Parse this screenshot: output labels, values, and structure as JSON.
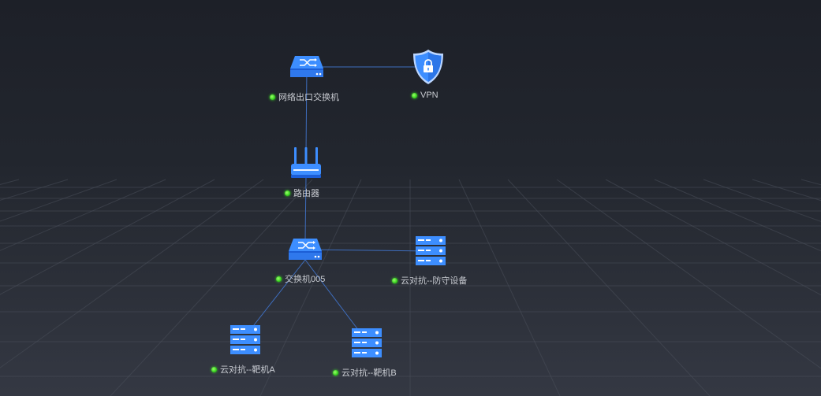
{
  "colors": {
    "device": "#3d8eff",
    "device_dark": "#1c5ed6",
    "status_online": "#3fe326",
    "link": "#3e6dbd",
    "grid": "#4a4f5a"
  },
  "nodes": {
    "exit_switch": {
      "label": "网络出口交换机",
      "icon": "switch-icon",
      "status": "online"
    },
    "vpn": {
      "label": "VPN",
      "icon": "vpn-shield-icon",
      "status": "online"
    },
    "router": {
      "label": "路由器",
      "icon": "router-icon",
      "status": "online"
    },
    "switch005": {
      "label": "交换机005",
      "icon": "switch-icon",
      "status": "online"
    },
    "defense": {
      "label": "云对抗--防守设备",
      "icon": "server-rack-icon",
      "status": "online"
    },
    "target_a": {
      "label": "云对抗--靶机A",
      "icon": "server-rack-icon",
      "status": "online"
    },
    "target_b": {
      "label": "云对抗--靶机B",
      "icon": "server-rack-icon",
      "status": "online"
    }
  },
  "links": [
    {
      "from": "exit_switch",
      "to": "vpn"
    },
    {
      "from": "exit_switch",
      "to": "router"
    },
    {
      "from": "router",
      "to": "switch005"
    },
    {
      "from": "switch005",
      "to": "defense"
    },
    {
      "from": "switch005",
      "to": "target_a"
    },
    {
      "from": "switch005",
      "to": "target_b"
    }
  ]
}
